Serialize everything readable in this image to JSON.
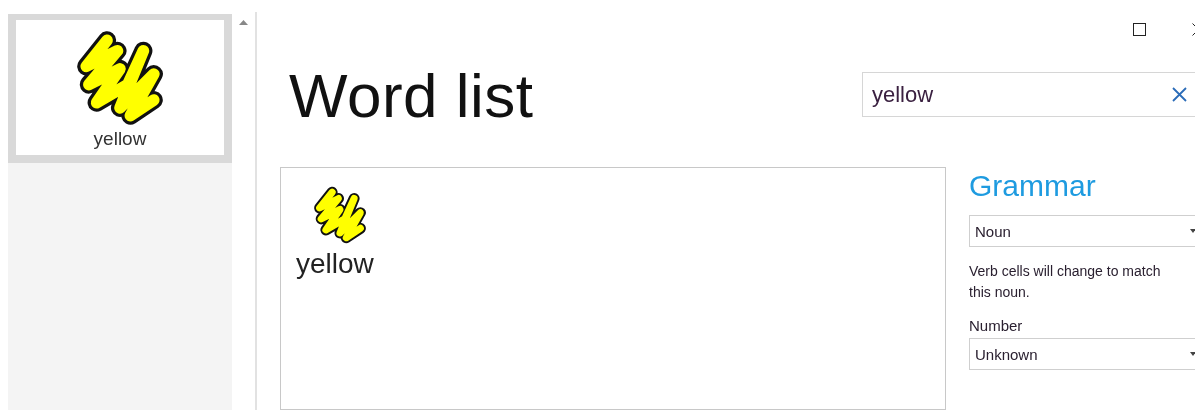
{
  "sidebar": {
    "items": [
      {
        "label": "yellow",
        "selected": true
      }
    ]
  },
  "page": {
    "title": "Word list"
  },
  "search": {
    "value": "yellow"
  },
  "card": {
    "label": "yellow"
  },
  "grammar": {
    "heading": "Grammar",
    "type_select": {
      "value": "Noun"
    },
    "hint": "Verb cells will change to match this noun.",
    "number_label": "Number",
    "number_select": {
      "value": "Unknown"
    }
  }
}
